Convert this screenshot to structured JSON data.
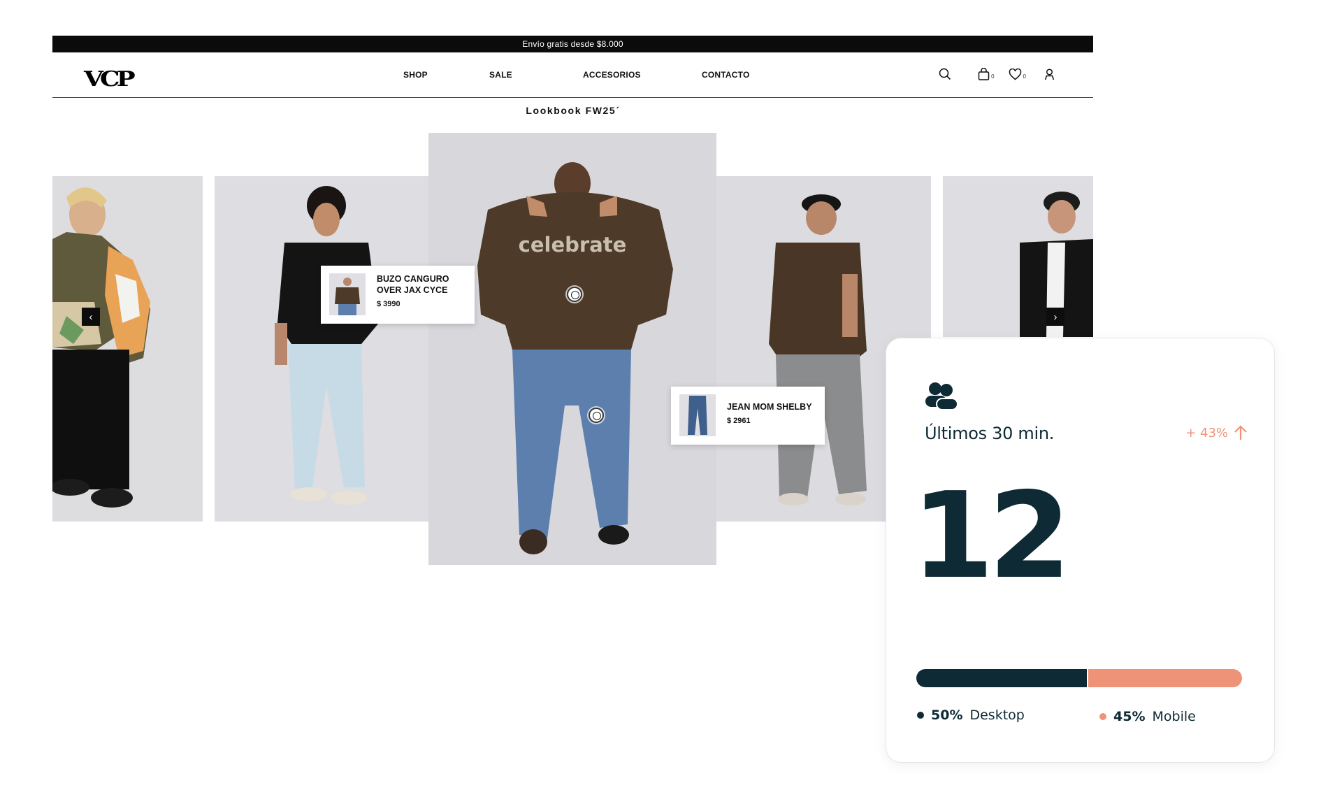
{
  "announcement": "Envío gratis desde $8.000",
  "brand": "VCP",
  "nav": {
    "items": [
      "SHOP",
      "SALE",
      "ACCESORIOS",
      "CONTACTO"
    ]
  },
  "header_icons": {
    "search": "search-icon",
    "cart": {
      "icon": "bag-icon",
      "count": "0"
    },
    "wishlist": {
      "icon": "heart-icon",
      "count": "0"
    },
    "account": "user-icon"
  },
  "lookbook": {
    "title": "Lookbook FW25´",
    "prev_arrow": "‹",
    "next_arrow": "›",
    "products": [
      {
        "name": "BUZO CANGURO\nOVER JAX CYCE",
        "price": "$ 3990"
      },
      {
        "name": "JEAN MOM SHELBY",
        "price": "$ 2961"
      }
    ],
    "hoodie_print": "celebrate"
  },
  "widget": {
    "period": "Últimos 30 min.",
    "change": "+ 43%",
    "value": "12",
    "desktop": {
      "percent": "50%",
      "label": "Desktop",
      "share": 0.5
    },
    "mobile": {
      "percent": "45%",
      "label": "Mobile",
      "share": 0.45
    },
    "colors": {
      "dark": "#0e2a35",
      "accent": "#ee9377"
    }
  }
}
